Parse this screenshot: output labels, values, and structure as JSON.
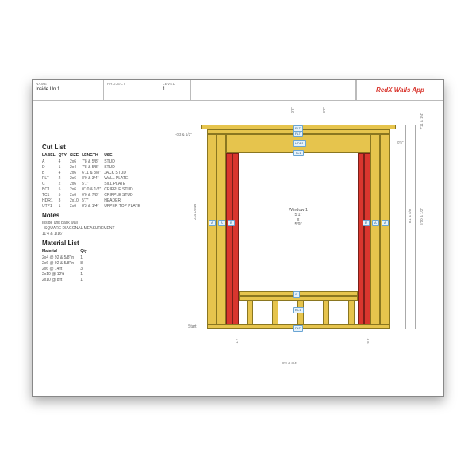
{
  "header": {
    "name_label": "NAME",
    "name_value": "Inside Un 1",
    "project_label": "PROJECT",
    "project_value": "",
    "level_label": "LEVEL",
    "level_value": "1",
    "brand": "RedX Walls App"
  },
  "cutlist": {
    "title": "Cut List",
    "cols": {
      "label": "LABEL",
      "qty": "QTY",
      "size": "SIZE",
      "length": "LENGTH",
      "use": "USE"
    },
    "rows": [
      {
        "label": "A",
        "qty": "4",
        "size": "2x6",
        "length": "7'8 & 5/8\"",
        "use": "STUD"
      },
      {
        "label": "D",
        "qty": "1",
        "size": "2x4",
        "length": "7'8 & 5/8\"",
        "use": "STUD"
      },
      {
        "label": "B",
        "qty": "4",
        "size": "2x6",
        "length": "6'11 & 3/8\"",
        "use": "JACK STUD"
      },
      {
        "label": "PLT",
        "qty": "2",
        "size": "2x6",
        "length": "8'0 & 3/4\"",
        "use": "WALL PLATE"
      },
      {
        "label": "C",
        "qty": "2",
        "size": "2x6",
        "length": "5'1\"",
        "use": "SILL PLATE"
      },
      {
        "label": "BC1",
        "qty": "5",
        "size": "2x6",
        "length": "0'10 & 1/2\"",
        "use": "CRIPPLE STUD"
      },
      {
        "label": "TC1",
        "qty": "5",
        "size": "2x6",
        "length": "0'0 & 7/8\"",
        "use": "CRIPPLE STUD"
      },
      {
        "label": "HDR1",
        "qty": "3",
        "size": "2x10",
        "length": "5'7\"",
        "use": "HEADER"
      },
      {
        "label": "UTP1",
        "qty": "1",
        "size": "2x6",
        "length": "8'3 & 1/4\"",
        "use": "UPPER TOP PLATE"
      }
    ]
  },
  "notes": {
    "title": "Notes",
    "lines": [
      "Inside unit back wall",
      "- SQUARE DIAGONAL MEASUREMENT",
      "11'4 & 1/16\""
    ]
  },
  "materials": {
    "title": "Material List",
    "cols": {
      "material": "Material",
      "qty": "Qty"
    },
    "rows": [
      {
        "material": "2x4 @ 92 & 5/8\"in",
        "qty": "1"
      },
      {
        "material": "2x6 @ 92 & 5/8\"in",
        "qty": "8"
      },
      {
        "material": "2x6 @ 14'ft",
        "qty": "3"
      },
      {
        "material": "2x10 @ 12'ft",
        "qty": "1"
      },
      {
        "material": "2x10 @ 8'ft",
        "qty": "1"
      }
    ]
  },
  "drawing": {
    "window_name": "Window 1",
    "window_w": "5'1\"",
    "window_sep": "x",
    "window_h": "5'9\"",
    "tags": {
      "plt": "PLT",
      "hdr": "HDR1",
      "tc1": "TC1",
      "bc1": "BC1",
      "a": "A",
      "b": "B",
      "c": "C"
    },
    "dims": {
      "top_left": "-0'3 & 1/2\"",
      "top_a": "0'8\"",
      "top_b": "0'8\"",
      "right_top": "7'11 & 1/4\"",
      "right_mid1": "0'5\"",
      "right_main": "8'1 & 5/8\"",
      "right_mid2": "6'10 & 1/2\"",
      "bottom_span": "8'0 & 3/4\"",
      "bottom_left": "1'7\"",
      "bottom_right": "6'9\"",
      "vert_label": "2x4 Down",
      "start": "Start"
    }
  }
}
